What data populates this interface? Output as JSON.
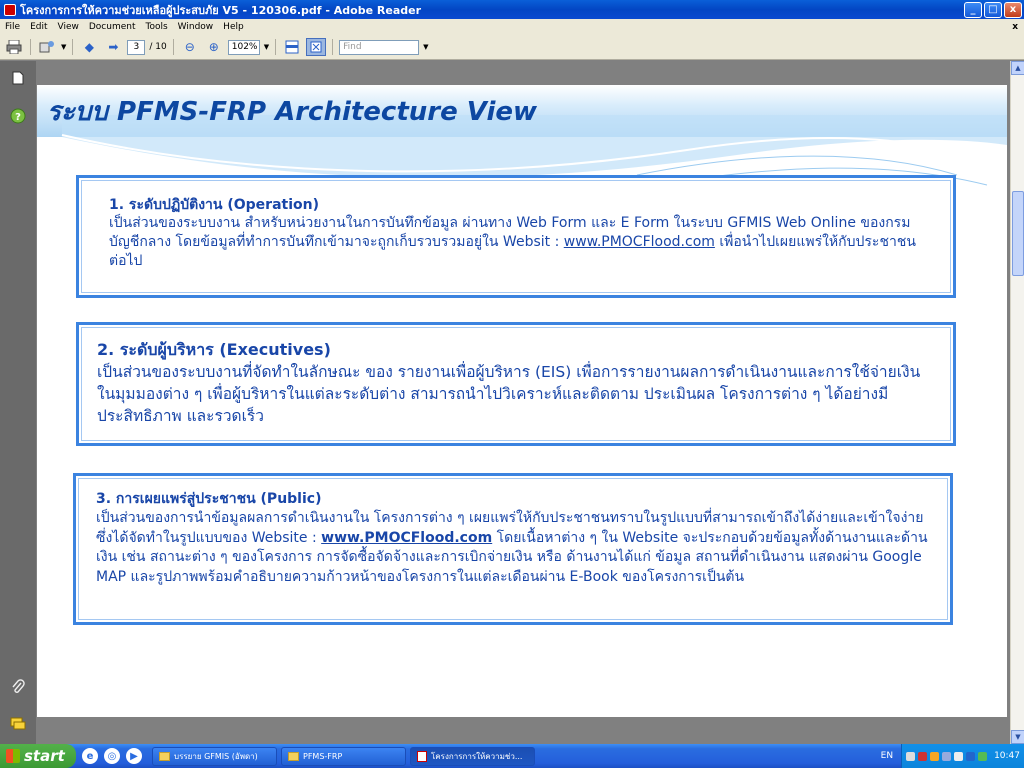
{
  "window": {
    "title": "โครงการการให้ความช่วยเหลือผู้ประสบภัย V5 - 120306.pdf - Adobe Reader",
    "minimize": "_",
    "maximize": "□",
    "close": "x"
  },
  "menu": {
    "items": [
      "File",
      "Edit",
      "View",
      "Document",
      "Tools",
      "Window",
      "Help"
    ],
    "close_doc": "x"
  },
  "toolbar": {
    "page_current": "3",
    "page_total": "/ 10",
    "zoom": "102%",
    "find_placeholder": "Find"
  },
  "slide": {
    "title": "ระบบ PFMS-FRP Architecture View",
    "boxes": [
      {
        "heading": "1. ระดับปฏิบัติงาน (Operation)",
        "body_before_link": "เป็นส่วนของระบบงาน สำหรับหน่วยงานในการบันทึกข้อมูล ผ่านทาง Web Form และ E Form ในระบบ GFMIS Web Online ของกรมบัญชีกลาง โดยข้อมูลที่ทำการบันทึกเข้ามาจะถูกเก็บรวบรวมอยู่ใน Websit : ",
        "link": "www.PMOCFlood.com",
        "body_after_link": " เพื่อนำไปเผยแพร่ให้กับประชาชนต่อไป"
      },
      {
        "heading": "2. ระดับผู้บริหาร (Executives)",
        "body": "เป็นส่วนของระบบงานที่จัดทำในลักษณะ ของ รายงานเพื่อผู้บริหาร (EIS) เพื่อการรายงานผลการดำเนินงานและการใช้จ่ายเงินในมุมมองต่าง ๆ เพื่อผู้บริหารในแต่ละระดับต่าง สามารถนำไปวิเคราะห์และติดตาม ประเมินผล โครงการต่าง ๆ ได้อย่างมีประสิทธิภาพ และรวดเร็ว"
      },
      {
        "heading": "3. การเผยแพร่สู่ประชาชน (Public)",
        "body_before_link": "เป็นส่วนของการนำข้อมูลผลการดำเนินงานใน โครงการต่าง ๆ เผยแพร่ให้กับประชาชนทราบในรูปแบบที่สามารถเข้าถึงได้ง่ายและเข้าใจง่าย ซึ่งได้จัดทำในรูปแบบของ Website : ",
        "link": "www.PMOCFlood.com",
        "body_after_link": " โดยเนื้อหาต่าง ๆ ใน Website จะประกอบด้วยข้อมูลทั้งด้านงานและด้านเงิน เช่น สถานะต่าง ๆ ของโครงการ การจัดซื้อจัดจ้างและการเบิกจ่ายเงิน หรือ ด้านงานได้แก่ ข้อมูล สถานที่ดำเนินงาน แสดงผ่าน Google MAP และรูปภาพพร้อมคำอธิบายความก้าวหน้าของโครงการในแต่ละเดือนผ่าน E-Book ของโครงการเป็นต้น"
      }
    ]
  },
  "taskbar": {
    "start_label": "start",
    "tasks": [
      "บรรยาย GFMIS (อัพดา)",
      "PFMS-FRP",
      "โครงการการให้ความช่ว..."
    ],
    "language": "EN",
    "clock": "10:47"
  },
  "colors": {
    "accent_blue": "#3b83e0",
    "text_blue": "#1946a8",
    "title_blue": "#0d47a1"
  }
}
